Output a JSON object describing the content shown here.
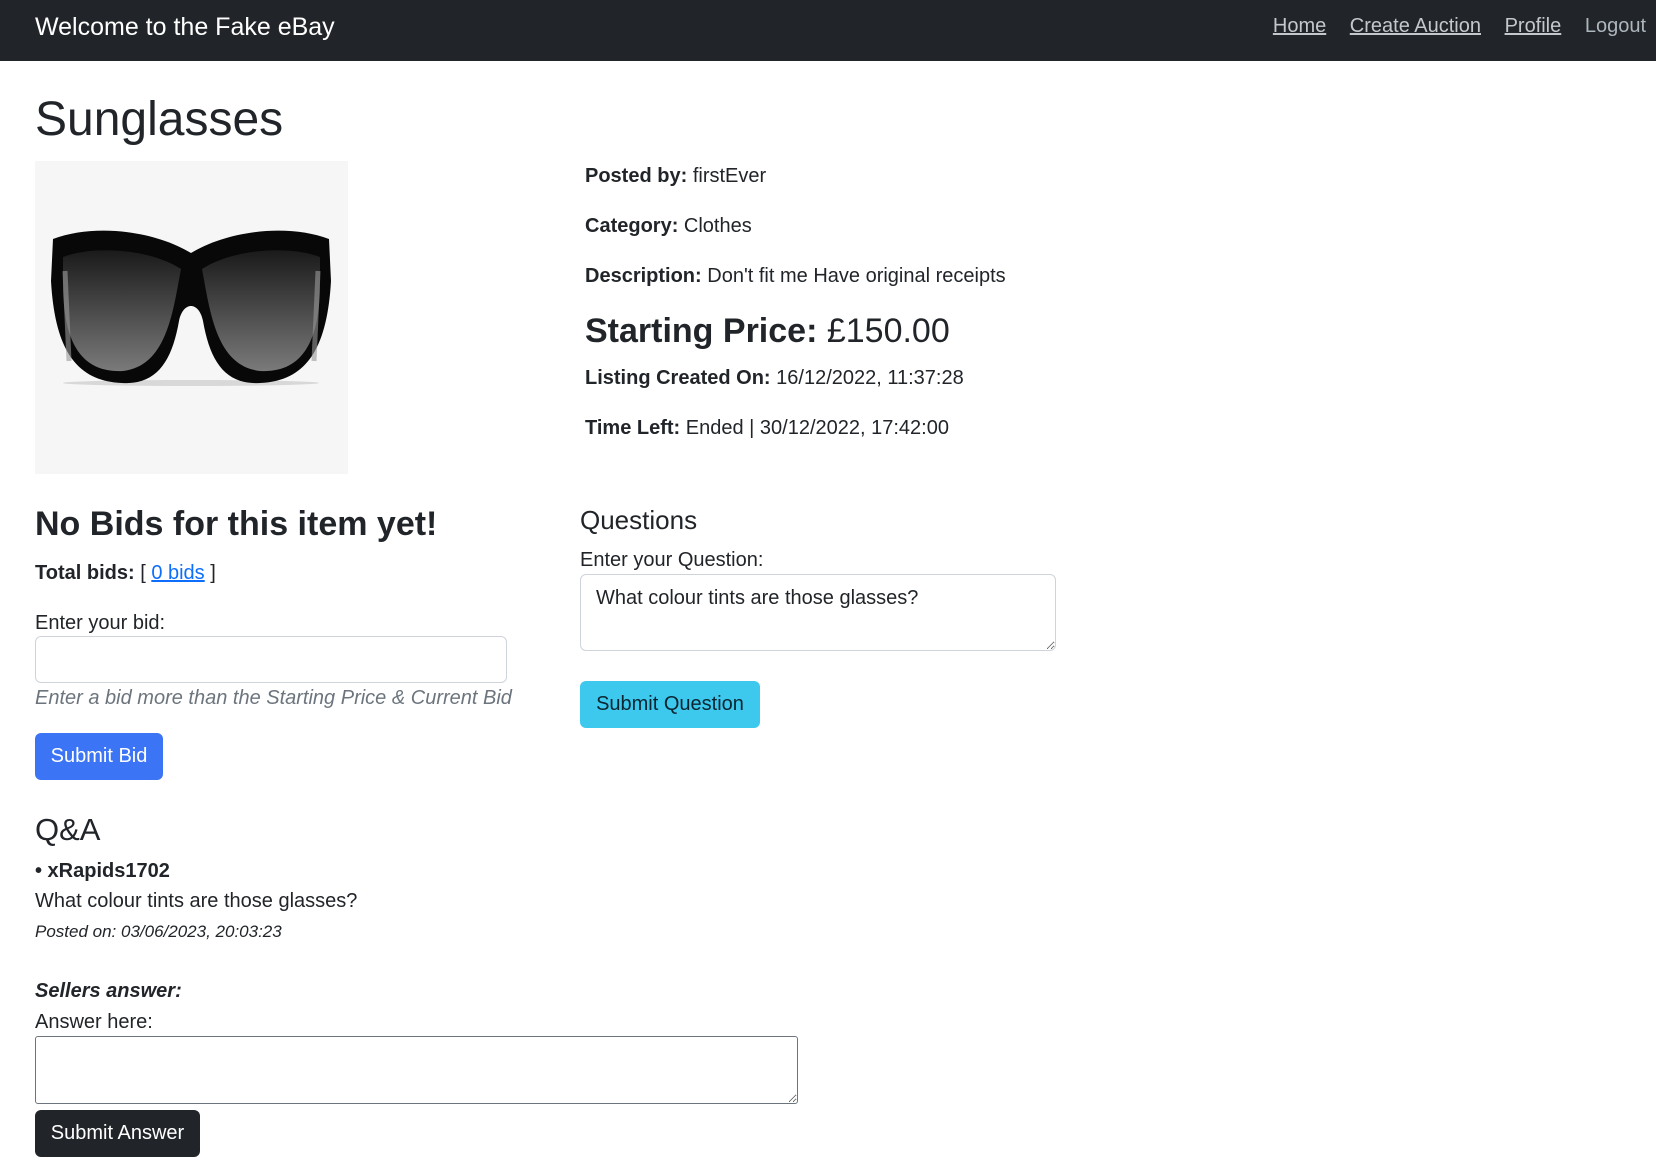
{
  "nav": {
    "brand": "Welcome to the Fake eBay",
    "links": [
      "Home",
      "Create Auction",
      "Profile",
      "Logout"
    ]
  },
  "item": {
    "title": "Sunglasses",
    "image_alt": "Sunglasses",
    "posted_by_label": "Posted by:",
    "posted_by": "firstEver",
    "category_label": "Category:",
    "category": "Clothes",
    "description_label": "Description:",
    "description": "Don't fit me Have original receipts",
    "starting_price_label": "Starting Price:",
    "starting_price": "£150.00",
    "created_label": "Listing Created On:",
    "created": "16/12/2022, 11:37:28",
    "time_left_label": "Time Left:",
    "time_left": "Ended | 30/12/2022, 17:42:00"
  },
  "bids": {
    "heading": "No Bids for this item yet!",
    "total_label": "Total bids:",
    "bracket_open": "[",
    "bids_link": "0 bids",
    "bracket_close": "]",
    "enter_label": "Enter your bid:",
    "input_value": "",
    "hint": "Enter a bid more than the Starting Price & Current Bid",
    "submit": "Submit Bid"
  },
  "questions": {
    "heading": "Questions",
    "enter_label": "Enter your Question:",
    "input_value": "What colour tints are those glasses?",
    "submit": "Submit Question"
  },
  "qa": {
    "heading": "Q&A",
    "entries": [
      {
        "asker": "• xRapids1702",
        "question": "What colour tints are those glasses?",
        "posted": "Posted on: 03/06/2023, 20:03:23",
        "sellers_answer_label": "Sellers answer:",
        "answer_label": "Answer here:",
        "answer_value": "",
        "submit": "Submit Answer"
      }
    ]
  },
  "colors": {
    "navbar": "#212529",
    "primary": "#3b74f5",
    "info": "#3dc8ee",
    "dark": "#212529",
    "link": "#0d6efd"
  }
}
